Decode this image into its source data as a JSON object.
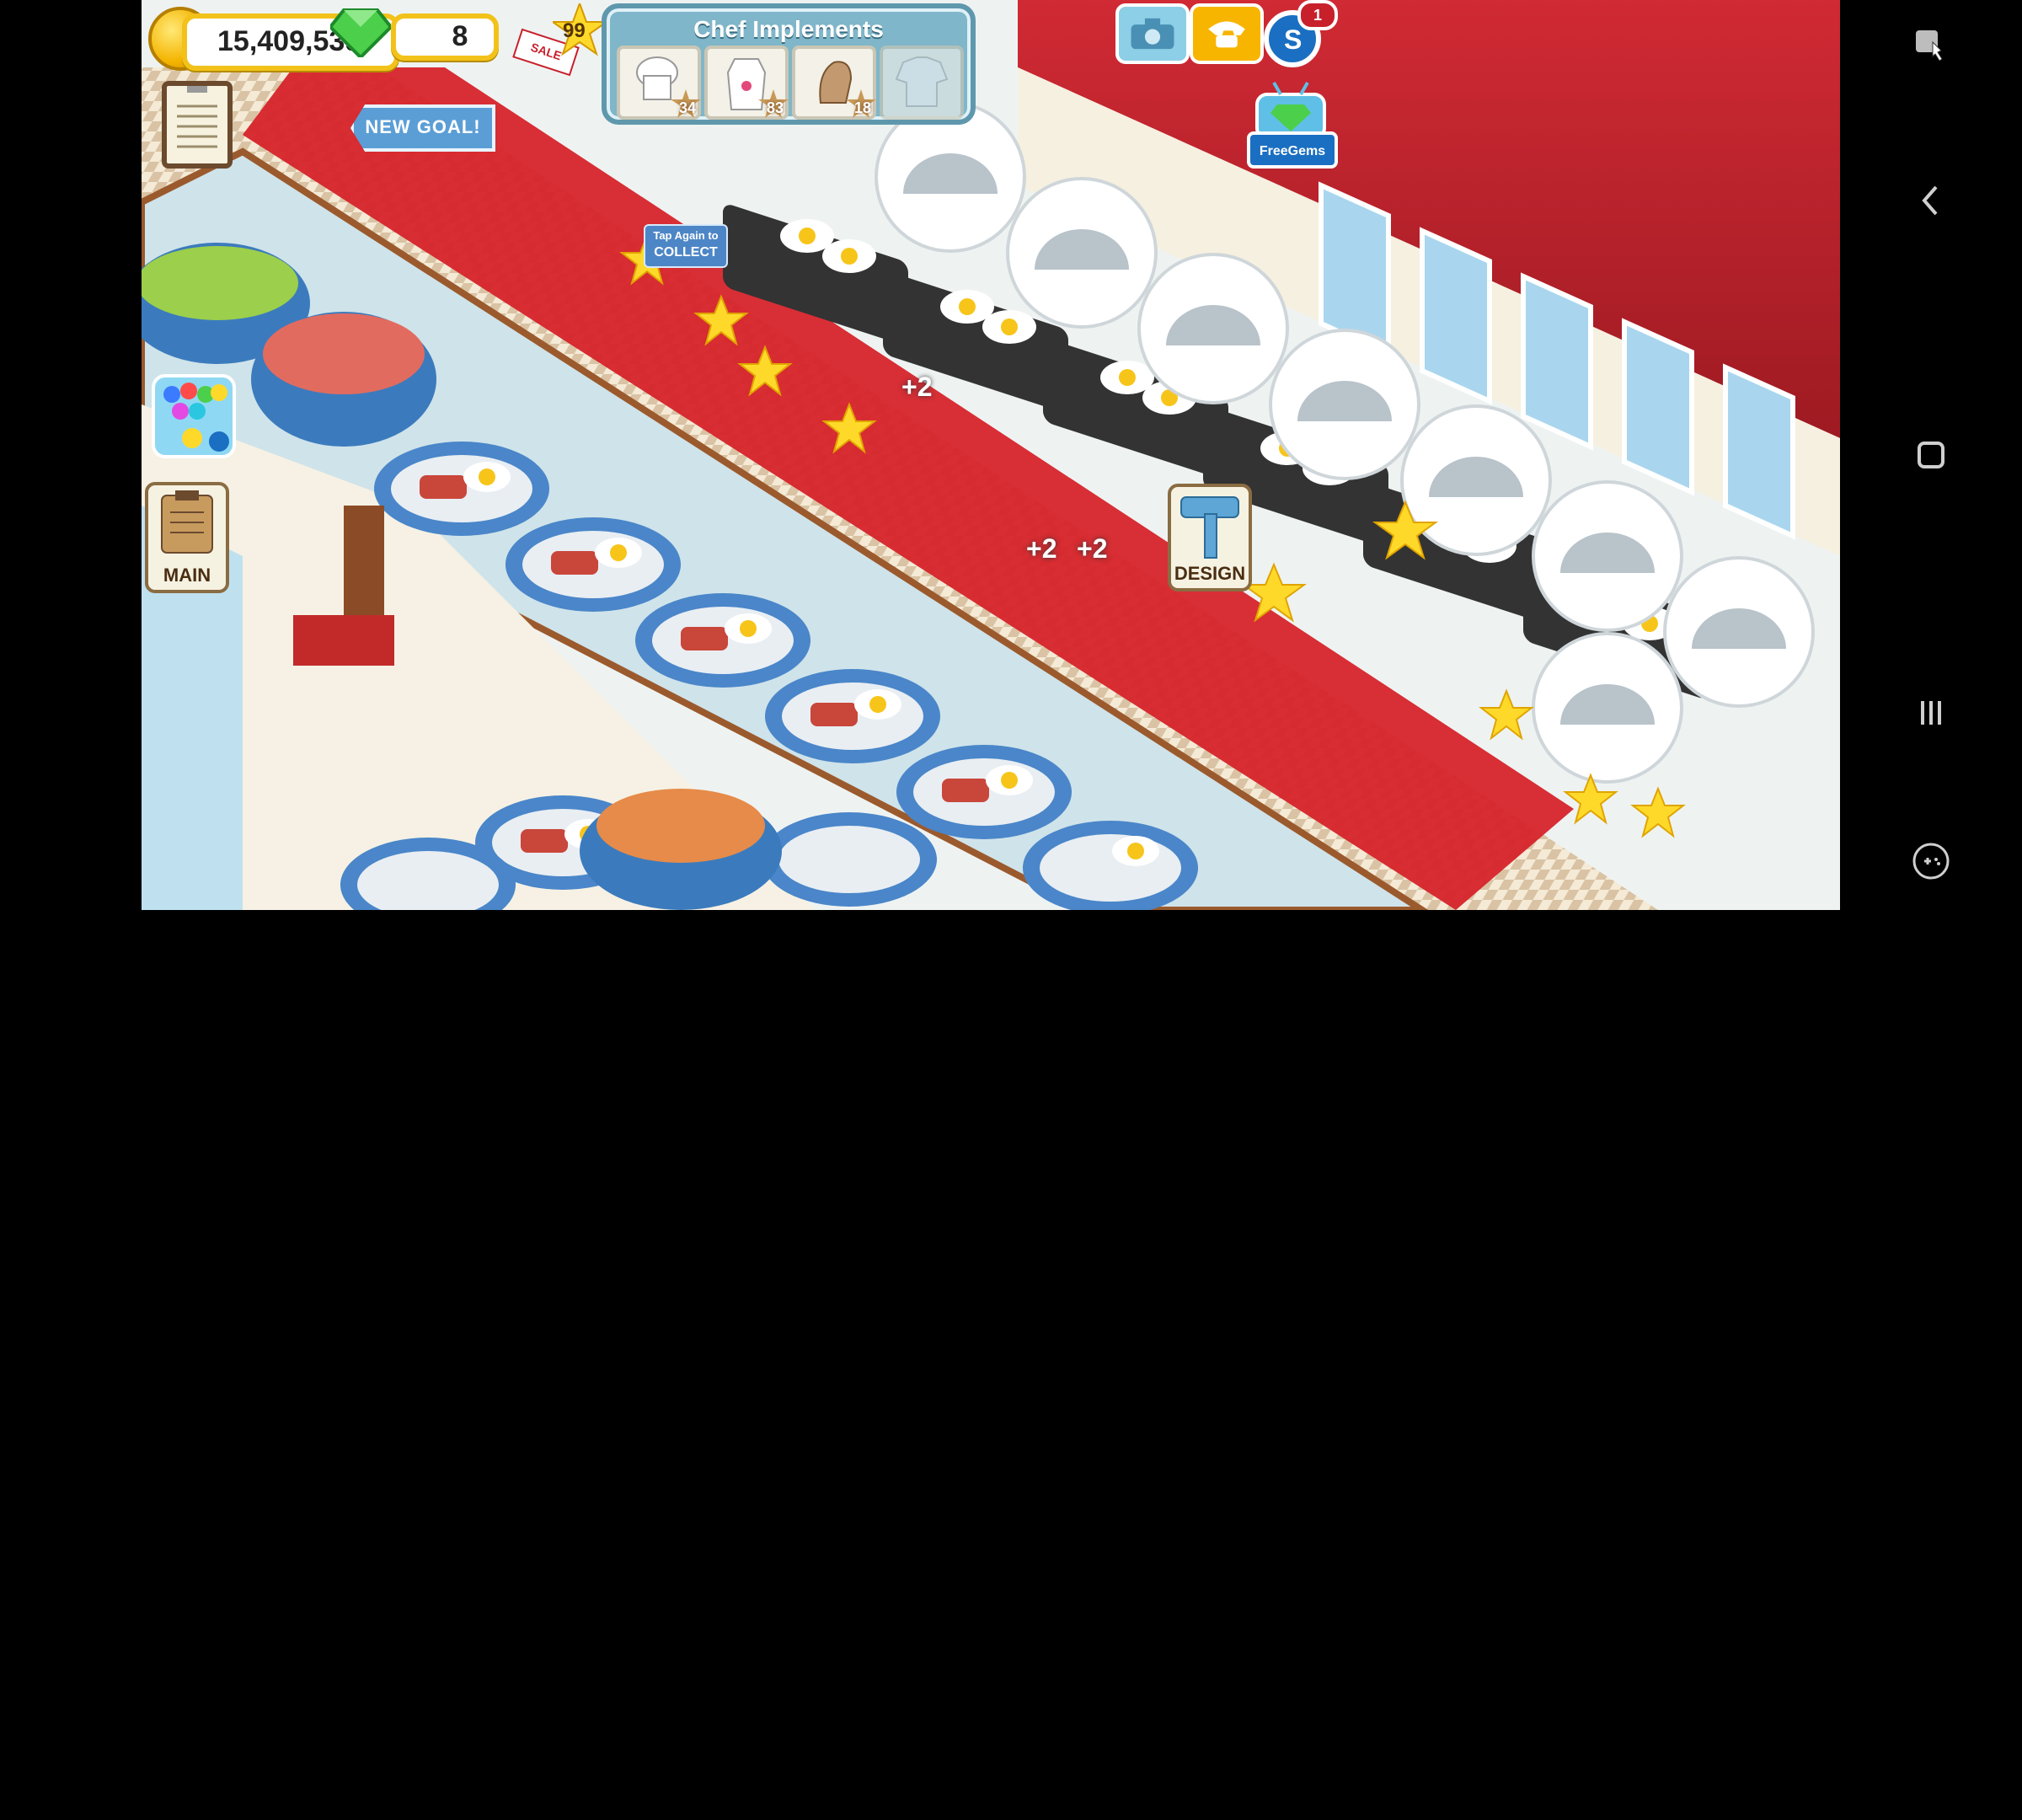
{
  "hud": {
    "coins": "15,409,539",
    "gems": "8",
    "level_partial": "99",
    "sale_tag": "SALE"
  },
  "panel": {
    "title": "Chef Implements",
    "items": [
      {
        "name": "chef-hat",
        "count": "34"
      },
      {
        "name": "apron",
        "count": "83"
      },
      {
        "name": "oven-mitt",
        "count": "18"
      },
      {
        "name": "chef-jacket",
        "count": ""
      }
    ]
  },
  "goal": {
    "label": "NEW GOAL!"
  },
  "collect": {
    "line1": "Tap Again to",
    "line2": "COLLECT"
  },
  "floaters": [
    "+2",
    "+2",
    "+2"
  ],
  "buttons": {
    "main": "MAIN",
    "design": "DESIGN",
    "freegems": "FreeGems",
    "notif_count": "1"
  },
  "colors": {
    "accent_gold": "#f2c21a",
    "panel_blue": "#7fb6c9",
    "carpet_red": "#d6232a",
    "wall_red": "#c8202b"
  }
}
